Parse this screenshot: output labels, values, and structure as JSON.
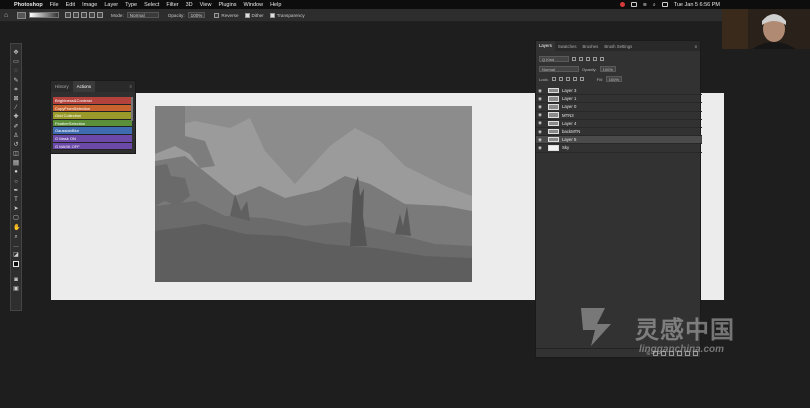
{
  "menubar": {
    "app": "Photoshop",
    "items": [
      "File",
      "Edit",
      "Image",
      "Layer",
      "Type",
      "Select",
      "Filter",
      "3D",
      "View",
      "Plugins",
      "Window",
      "Help"
    ],
    "datetime": "Tue Jan 5  6:56 PM"
  },
  "options": {
    "mode_label": "Mode:",
    "mode_value": "Normal",
    "opacity_label": "Opacity:",
    "opacity_value": "100%",
    "reverse_label": "Reverse",
    "dither_label": "Dither",
    "transparency_label": "Transparency"
  },
  "actions_panel": {
    "tabs": [
      "History",
      "Actions"
    ],
    "items": [
      {
        "label": "Brightness&Contrast",
        "color": "#b2423b"
      },
      {
        "label": "CopyFromSelection",
        "color": "#c8632f"
      },
      {
        "label": "Grid Collection",
        "color": "#9a9a2a"
      },
      {
        "label": "FeatherSelection",
        "color": "#5b8f3a"
      },
      {
        "label": "GaussianBlur",
        "color": "#3f6bb0"
      },
      {
        "label": "G Mask ON",
        "color": "#6a49a8"
      },
      {
        "label": "G MASK OFF",
        "color": "#6a49a8"
      }
    ]
  },
  "layers_panel": {
    "tabs": [
      "Layers",
      "Swatches",
      "Brushes",
      "Brush Settings"
    ],
    "kind_label": "Q Kind",
    "blend_mode": "Normal",
    "opacity_label": "Opacity:",
    "opacity_value": "100%",
    "lock_label": "Lock:",
    "fill_label": "Fill:",
    "fill_value": "100%",
    "layers": [
      {
        "name": "Layer 3",
        "selected": false,
        "white": false
      },
      {
        "name": "Layer 1",
        "selected": false,
        "white": false
      },
      {
        "name": "Layer 0",
        "selected": false,
        "white": false
      },
      {
        "name": "MTN3",
        "selected": false,
        "white": false
      },
      {
        "name": "Layer 4",
        "selected": false,
        "white": false
      },
      {
        "name": "backMTN",
        "selected": false,
        "white": false
      },
      {
        "name": "Layer 5",
        "selected": true,
        "white": false
      },
      {
        "name": "Sky",
        "selected": false,
        "white": true
      }
    ],
    "footer_fx": "fx"
  },
  "watermark": {
    "cn": "灵感中国",
    "en": "lingganchina.com"
  },
  "icons": [
    "apple-icon",
    "record-icon",
    "wifi-icon",
    "search-icon",
    "home-icon",
    "eye-icon",
    "move-tool-icon",
    "gradient-tool-icon"
  ]
}
